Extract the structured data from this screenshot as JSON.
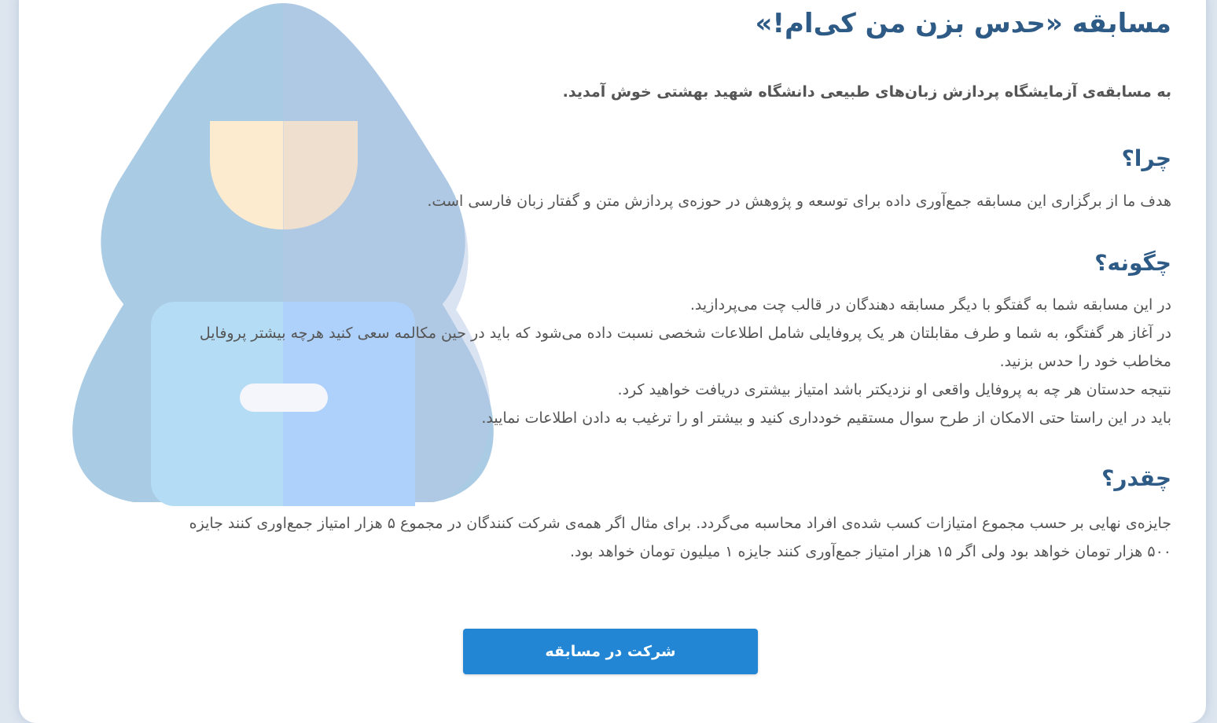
{
  "title": "مسابقه «حدس بزن من کی‌ام!»",
  "intro": "به مسابقه‌ی آزمایشگاه پردازش زبان‌های طبیعی دانشگاه شهید بهشتی خوش آمدید.",
  "why": {
    "heading": "چرا؟",
    "text": "هدف ما از برگزاری این مسابقه جمع‌آوری داده برای توسعه و پژوهش در حوزه‌ی پردازش متن و گفتار زبان فارسی است."
  },
  "how": {
    "heading": "چگونه؟",
    "lines": [
      "در این مسابقه شما به گفتگو با دیگر مسابقه دهندگان در قالب چت می‌پردازید.",
      "در آغاز هر گفتگو، به شما و طرف مقابلتان هر یک پروفایلی شامل اطلاعات شخصی نسبت داده می‌شود که باید در حین مکالمه سعی کنید هرچه بیشتر پروفایل",
      "مخاطب خود را حدس بزنید.",
      "نتیجه حدستان هر چه به پروفایل واقعی او نزدیکتر باشد امتیاز بیشتری دریافت خواهید کرد.",
      "باید در این راستا حتی الامکان از طرح سوال مستقیم خودداری کنید و بیشتر او را ترغیب به دادن اطلاعات نمایید."
    ]
  },
  "howmuch": {
    "heading": "چقدر؟",
    "lines": [
      "جایزه‌ی نهایی بر حسب مجموع امتیازات کسب شده‌ی افراد محاسبه می‌گردد. برای مثال اگر همه‌ی شرکت کنندگان در مجموع ۵ هزار امتیاز جمع‌اوری کنند جایزه",
      "۵۰۰ هزار تومان خواهد بود ولی اگر ۱۵ هزار امتیاز جمع‌آوری کنند جایزه ۱ میلیون تومان خواهد بود."
    ]
  },
  "button": {
    "label": "شرکت در مسابقه"
  },
  "illustration": {
    "icon": "hooded-figure-icon"
  },
  "colors": {
    "heading": "#2e5a86",
    "text": "#555555",
    "button": "#2286d4",
    "background": "#dde6ef"
  }
}
